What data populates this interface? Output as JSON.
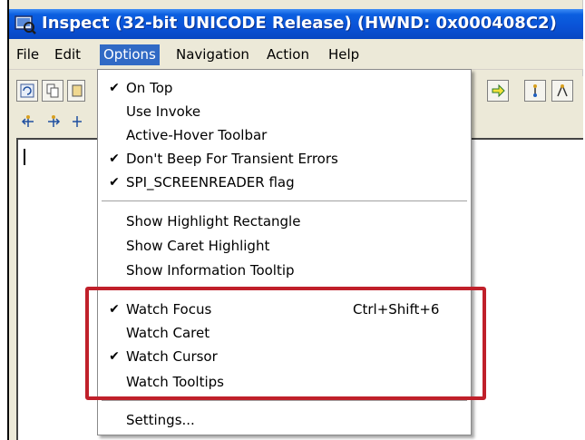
{
  "window": {
    "title": "Inspect  (32-bit UNICODE Release) (HWND: 0x000408C2)",
    "title_icon": "inspect-app-icon",
    "accent_color": "#0a52d6"
  },
  "menubar": {
    "items": [
      {
        "label": "File",
        "name": "menu-file"
      },
      {
        "label": "Edit",
        "name": "menu-edit"
      },
      {
        "label": "Options",
        "name": "menu-options",
        "active": true
      },
      {
        "label": "Navigation",
        "name": "menu-navigation"
      },
      {
        "label": "Action",
        "name": "menu-action"
      },
      {
        "label": "Help",
        "name": "menu-help"
      }
    ]
  },
  "options_menu": {
    "groups": [
      [
        {
          "label": "On Top",
          "checked": true
        },
        {
          "label": "Use Invoke",
          "checked": false
        },
        {
          "label": "Active-Hover Toolbar",
          "checked": false
        },
        {
          "label": "Don't Beep For Transient Errors",
          "checked": true
        },
        {
          "label": "SPI_SCREENREADER flag",
          "checked": true
        }
      ],
      [
        {
          "label": "Show Highlight Rectangle",
          "checked": false
        },
        {
          "label": "Show Caret Highlight",
          "checked": false
        },
        {
          "label": "Show Information Tooltip",
          "checked": false
        }
      ],
      [
        {
          "label": "Watch Focus",
          "checked": true,
          "shortcut": "Ctrl+Shift+6"
        },
        {
          "label": "Watch Caret",
          "checked": false
        },
        {
          "label": "Watch Cursor",
          "checked": true
        },
        {
          "label": "Watch Tooltips",
          "checked": false
        }
      ],
      [
        {
          "label": "Settings...",
          "checked": false
        }
      ]
    ],
    "check_glyph": "✔"
  },
  "annotation": {
    "highlight_color": "#c0202a"
  }
}
